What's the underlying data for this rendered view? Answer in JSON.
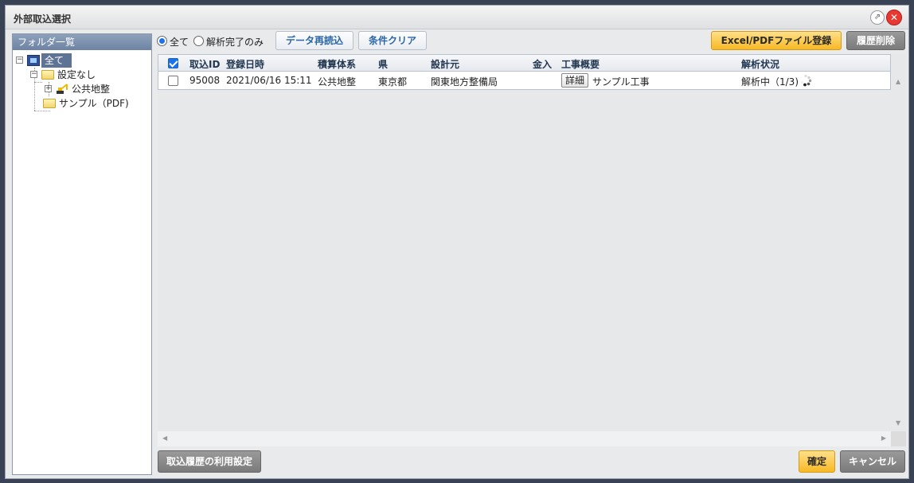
{
  "window": {
    "title": "外部取込選択",
    "popout_glyph": "⇗",
    "close_glyph": "✕"
  },
  "folder_panel": {
    "header": "フォルダ一覧",
    "tree": {
      "all": "全て",
      "unset": "設定なし",
      "public_land": "公共地整",
      "sample": "サンプル（PDF)"
    },
    "expander_open": "−",
    "expander_closed": "+"
  },
  "toolbar": {
    "radio_all": "全て",
    "radio_done": "解析完了のみ",
    "reload": "データ再読込",
    "clear": "条件クリア",
    "register": "Excel/PDFファイル登録",
    "delete_history": "履歴削除"
  },
  "grid": {
    "columns": [
      "取込ID",
      "登録日時",
      "積算体系",
      "県",
      "設計元",
      "金入",
      "工事概要",
      "解析状況"
    ],
    "rows": [
      {
        "id": "95008",
        "datetime": "2021/06/16 15:11",
        "system": "公共地整",
        "prefecture": "東京都",
        "designer": "関東地方整備局",
        "kinnyu": "",
        "detail_button": "詳細",
        "summary": "サンプル工事",
        "status": "解析中（1/3)"
      }
    ]
  },
  "footer": {
    "history_settings": "取込履歴の利用設定",
    "confirm": "確定",
    "cancel": "キャンセル"
  },
  "icons": {
    "all": "computer-icon",
    "folder": "folder-icon",
    "crane": "excavator-icon",
    "spinner": "loading-spinner-icon"
  },
  "colors": {
    "accent_blue": "#1a73e8",
    "selected_bg": "#5f7495",
    "primary_button": "#f7b924",
    "close_red": "#e8382f"
  }
}
